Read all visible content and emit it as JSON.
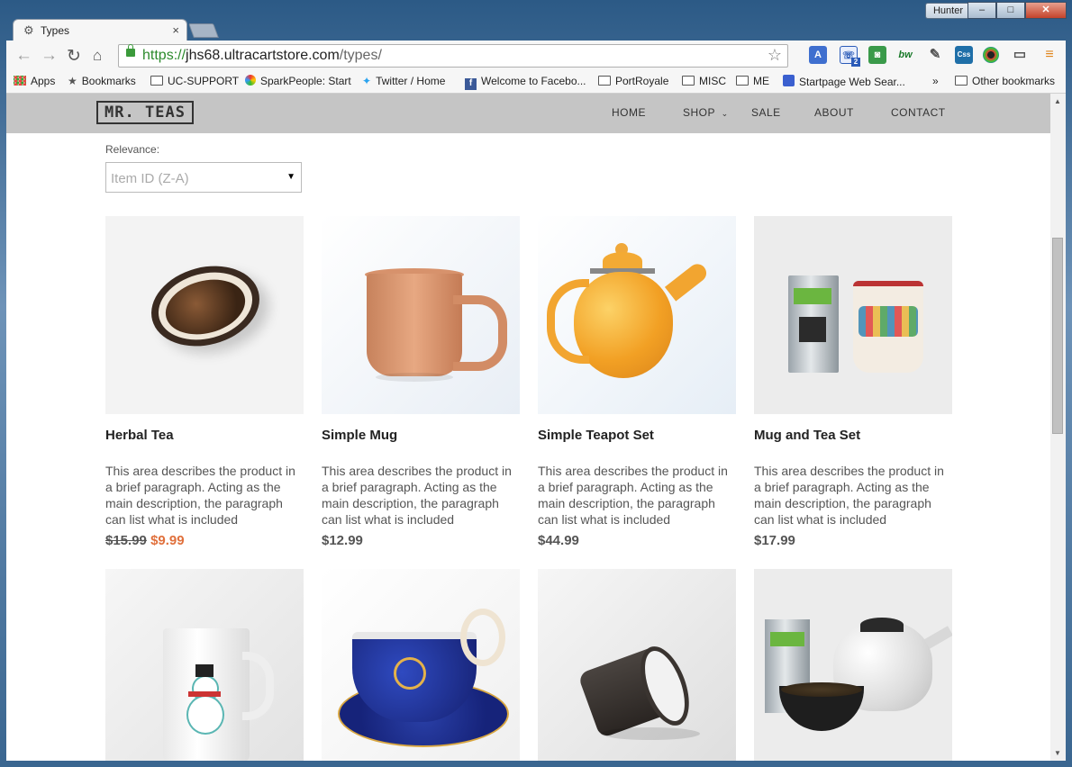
{
  "window": {
    "profile": "Hunter",
    "min": "–",
    "max": "□",
    "close": "✕"
  },
  "tab": {
    "title": "Types",
    "close": "×"
  },
  "address": {
    "scheme": "https://",
    "host": "jhs68.ultracartstore.com",
    "path": "/types/"
  },
  "bookmarks": [
    {
      "label": "Apps",
      "icon": "apps-grid-icon"
    },
    {
      "label": "Bookmarks",
      "icon": "star-icon"
    },
    {
      "label": "UC-SUPPORT",
      "icon": "folder-icon"
    },
    {
      "label": "SparkPeople: Start",
      "icon": "sparkpeople-icon"
    },
    {
      "label": "Twitter / Home",
      "icon": "twitter-icon"
    },
    {
      "label": "Welcome to Facebo...",
      "icon": "facebook-icon"
    },
    {
      "label": "PortRoyale",
      "icon": "folder-icon"
    },
    {
      "label": "MISC",
      "icon": "folder-icon"
    },
    {
      "label": "ME",
      "icon": "folder-icon"
    },
    {
      "label": "Startpage Web Sear...",
      "icon": "startpage-icon"
    }
  ],
  "bookmarks_overflow": "»",
  "other_bookmarks": "Other bookmarks",
  "extensions": {
    "ext_bw": "bw",
    "ext_css": "Css",
    "ext_badge": "2"
  },
  "site": {
    "logo": "MR. TEAS",
    "nav": {
      "home": "HOME",
      "shop": "SHOP",
      "sale": "SALE",
      "about": "ABOUT",
      "contact": "CONTACT"
    },
    "sort": {
      "label": "Relevance:",
      "value": "Item ID (Z-A)"
    },
    "products": [
      {
        "name": "Herbal Tea",
        "desc": "This area describes the product in a brief paragraph. Acting as the main description, the paragraph can list what is included",
        "old_price": "$15.99",
        "price": "$9.99"
      },
      {
        "name": "Simple Mug",
        "desc": "This area describes the product in a brief paragraph. Acting as the main description, the paragraph can list what is included",
        "price": "$12.99"
      },
      {
        "name": "Simple Teapot Set",
        "desc": "This area describes the product in a brief paragraph. Acting as the main description, the paragraph can list what is included",
        "price": "$44.99"
      },
      {
        "name": "Mug and Tea Set",
        "desc": "This area describes the product in a brief paragraph. Acting as the main description, the paragraph can list what is included",
        "price": "$17.99"
      }
    ]
  },
  "colors": {
    "accent_sale": "#e0703c",
    "header_bg": "#c5c5c5",
    "secure_green": "#2c8a2c"
  }
}
